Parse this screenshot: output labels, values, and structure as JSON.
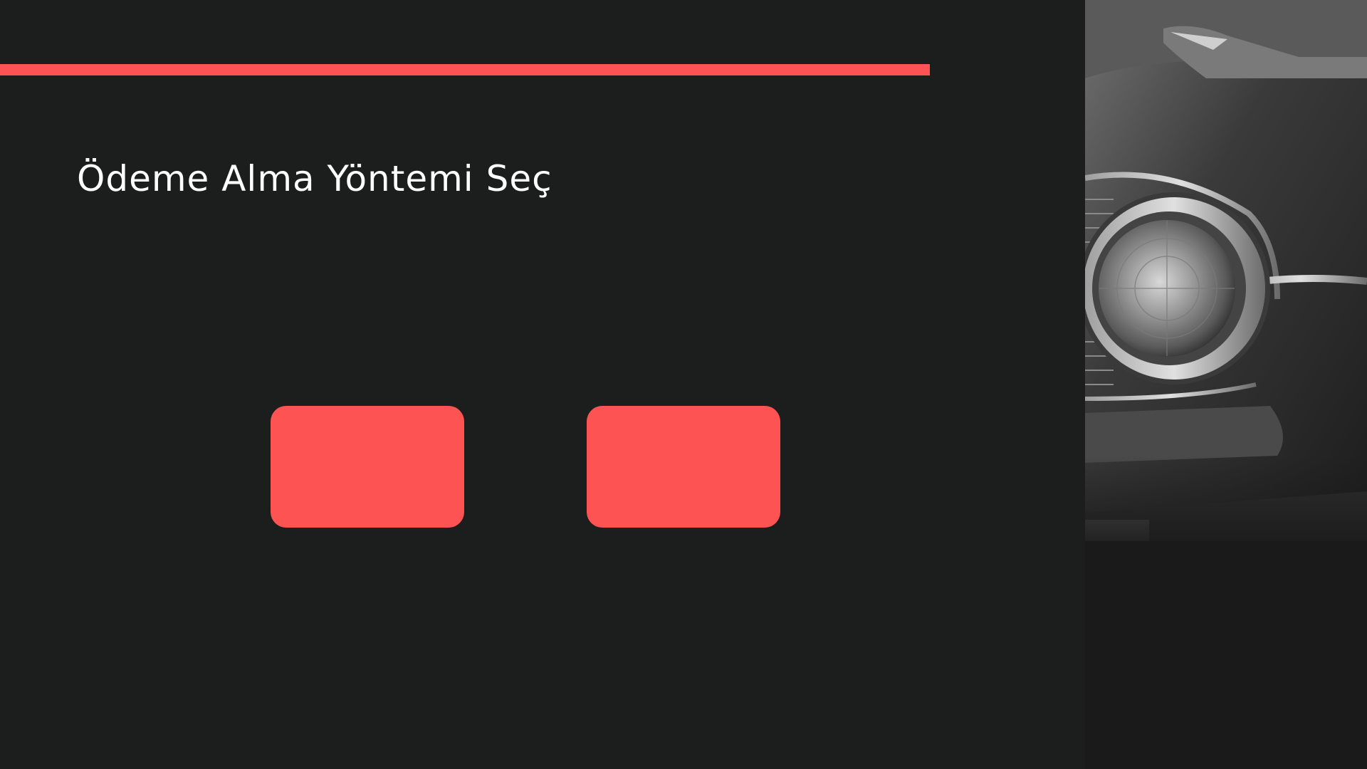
{
  "page": {
    "title": "Ödeme Alma Yöntemi Seç"
  },
  "options": [
    {
      "label": ""
    },
    {
      "label": ""
    }
  ],
  "colors": {
    "background": "#1c1e1e",
    "accent": "#fd5353",
    "title_text": "#ffffff"
  },
  "photo": {
    "subject": "black-and-white classic car headlight",
    "icon": "car-headlight-photo"
  }
}
